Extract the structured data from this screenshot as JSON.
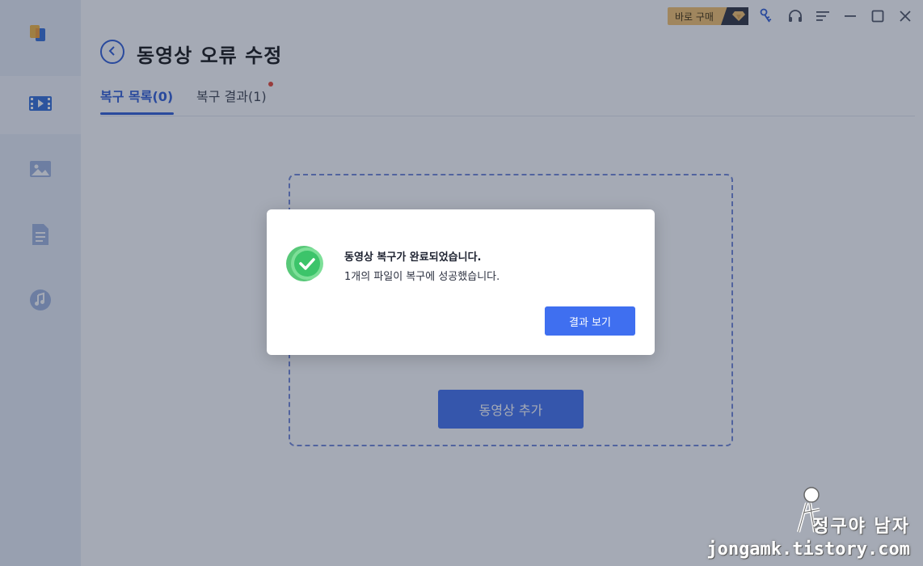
{
  "titlebar": {
    "buy_label": "바로 구매",
    "icons": [
      "diamond-icon",
      "key-icon",
      "headset-icon",
      "menu-icon",
      "minimize-icon",
      "maximize-icon",
      "close-icon"
    ]
  },
  "sidebar": {
    "items": [
      {
        "name": "video",
        "icon": "film-icon",
        "active": true
      },
      {
        "name": "photo",
        "icon": "image-icon",
        "active": false
      },
      {
        "name": "document",
        "icon": "document-icon",
        "active": false
      },
      {
        "name": "audio",
        "icon": "music-icon",
        "active": false
      }
    ]
  },
  "header": {
    "title": "동영상 오류 수정"
  },
  "tabs": [
    {
      "label": "복구 목록(0)",
      "active": true
    },
    {
      "label": "복구 결과(1)",
      "active": false,
      "badge": true
    }
  ],
  "main": {
    "add_button_label": "동영상 추가"
  },
  "dialog": {
    "title": "동영상 복구가 완료되었습니다.",
    "message": "1개의 파일이 복구에 성공했습니다.",
    "button_label": "결과 보기"
  },
  "watermark": {
    "name": "정구야 남자",
    "url": "jongamk.tistory.com"
  },
  "colors": {
    "accent": "#2b5bd6",
    "button": "#3f6ff0",
    "badge": "#e8432f",
    "success": "#3cc46a",
    "buy": "#f6c26a"
  }
}
